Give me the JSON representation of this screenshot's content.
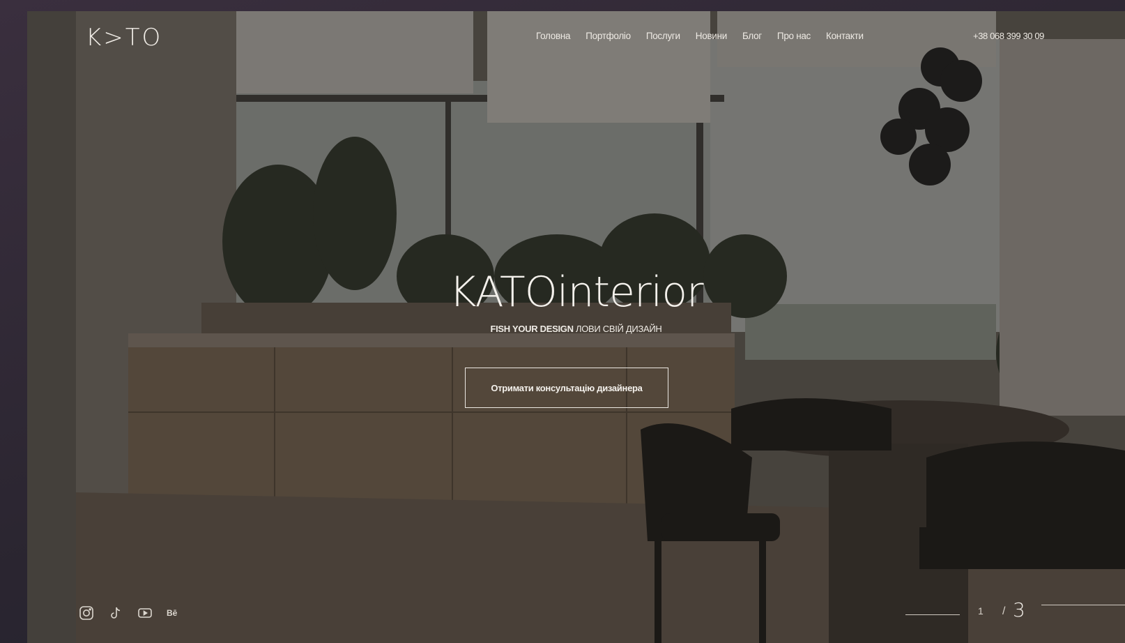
{
  "brand": {
    "logo_text": "K>TO"
  },
  "nav": {
    "items": [
      "Головна",
      "Портфоліо",
      "Послуги",
      "Новини",
      "Блог",
      "Про нас",
      "Контакти"
    ]
  },
  "contact": {
    "phone": "+38 068 399 30 09"
  },
  "hero": {
    "title": "KATOinterior",
    "tagline_bold": "FISH YOUR DESIGN",
    "tagline_rest": "ЛОВИ СВІЙ ДИЗАЙН",
    "cta_label": "Отримати консультацію дизайнера"
  },
  "social": {
    "icons": [
      "instagram-icon",
      "tiktok-icon",
      "youtube-icon",
      "behance-icon"
    ],
    "behance_text": "Bē"
  },
  "slider": {
    "current": "1",
    "separator": "/",
    "total": "3"
  }
}
